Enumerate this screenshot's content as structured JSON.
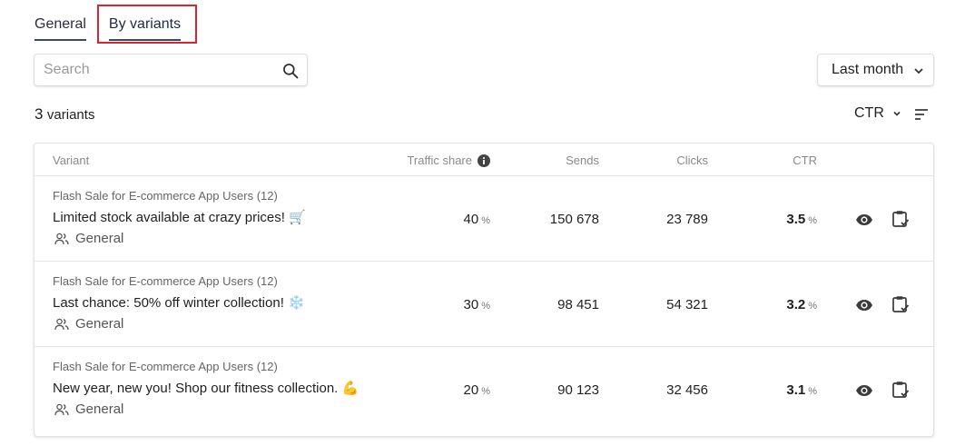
{
  "tabs": [
    {
      "label": "General"
    },
    {
      "label": "By variants"
    }
  ],
  "search": {
    "placeholder": "Search"
  },
  "period": {
    "label": "Last month"
  },
  "summary": {
    "count": "3",
    "unit": "variants"
  },
  "sort": {
    "label": "CTR"
  },
  "table": {
    "headers": {
      "variant": "Variant",
      "traffic": "Traffic share",
      "sends": "Sends",
      "clicks": "Clicks",
      "ctr": "CTR"
    },
    "rows": [
      {
        "campaign": "Flash Sale for E-commerce App Users (12)",
        "title": "Limited stock available at crazy prices! 🛒",
        "audience": "General",
        "traffic": "40",
        "traffic_unit": "%",
        "sends": "150 678",
        "clicks": "23 789",
        "ctr": "3.5",
        "ctr_unit": "%"
      },
      {
        "campaign": "Flash Sale for E-commerce App Users (12)",
        "title": "Last chance: 50% off winter collection! ❄️",
        "audience": "General",
        "traffic": "30",
        "traffic_unit": "%",
        "sends": "98 451",
        "clicks": "54 321",
        "ctr": "3.2",
        "ctr_unit": "%"
      },
      {
        "campaign": "Flash Sale for E-commerce App Users (12)",
        "title": "New year, new you! Shop our fitness collection. 💪",
        "audience": "General",
        "traffic": "20",
        "traffic_unit": "%",
        "sends": "90 123",
        "clicks": "32 456",
        "ctr": "3.1",
        "ctr_unit": "%"
      }
    ]
  },
  "icons": {
    "search": "search-icon",
    "dropdown": "chevron-down-icon",
    "sort": "sort-lines-icon",
    "info": "info-icon",
    "audience": "users-icon",
    "preview": "eye-icon",
    "copy": "clipboard-check-icon"
  },
  "colors": {
    "highlight": "#d7262d",
    "tab_underline": "#3b4a6b"
  }
}
